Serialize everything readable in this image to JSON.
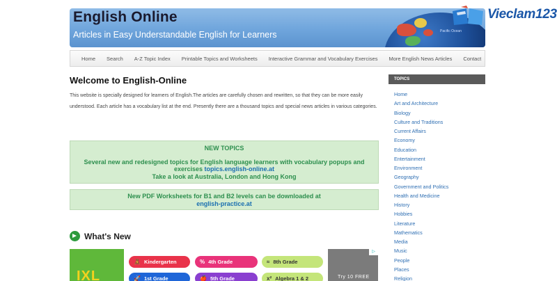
{
  "header": {
    "title": "English Online",
    "subtitle": "Articles in Easy Understandable English for Learners",
    "globe_label": "Pacific Ocean"
  },
  "logo": {
    "text": "Vieclam123"
  },
  "nav": {
    "items": [
      "Home",
      "Search",
      "A-Z Topic Index",
      "Printable Topics and Worksheets",
      "Interactive Grammar and Vocabulary Exercises",
      "More English News Articles",
      "Contact"
    ]
  },
  "main": {
    "welcome": "Welcome to English-Online",
    "intro": "This website is specially designed for learners of English.The articles are carefully chosen and rewritten, so that they can be more easily understood. Each article has a vocabulary list at the end. Presently there are a thousand topics and special news articles in various categories.",
    "box1": {
      "title": "NEW TOPICS",
      "line1": "Several new and redesigned topics for English language learners with vocabulary popups and",
      "line2_text": "exercises ",
      "line2_link": "topics.english-online.at",
      "line3": "Take a look at Australia, London and Hong Kong"
    },
    "box2": {
      "line1": "New PDF Worksheets for B1 and B2 levels can be downloaded at",
      "link": "english-practice.at"
    },
    "whats_new": "What's New"
  },
  "ad": {
    "brand": "IXL",
    "pills": [
      {
        "label": "Kindergarten",
        "icon": "🧸"
      },
      {
        "label": "4th Grade",
        "icon": "%"
      },
      {
        "label": "8th Grade",
        "icon": "≈"
      },
      {
        "label": "1st Grade",
        "icon": "🚀"
      },
      {
        "label": "5th Grade",
        "icon": "🍎"
      },
      {
        "label": "Algebra 1 & 2",
        "icon": "x²"
      }
    ],
    "right_text": "Try 10 FREE",
    "badge": "AdChoices"
  },
  "sidebar": {
    "heading": "TOPICS",
    "items": [
      "Home",
      "Art and Architecture",
      "Biology",
      "Culture and Traditions",
      "Current Affairs",
      "Economy",
      "Education",
      "Entertainment",
      "Environment",
      "Geography",
      "Government and Politics",
      "Health and Medicine",
      "History",
      "Hobbies",
      "Literature",
      "Mathematics",
      "Media",
      "Music",
      "People",
      "Places",
      "Religion"
    ]
  },
  "colors": {
    "accent_green": "#2d8f4e",
    "link_blue": "#2f6fb3",
    "box_bg": "#d5edd0"
  }
}
